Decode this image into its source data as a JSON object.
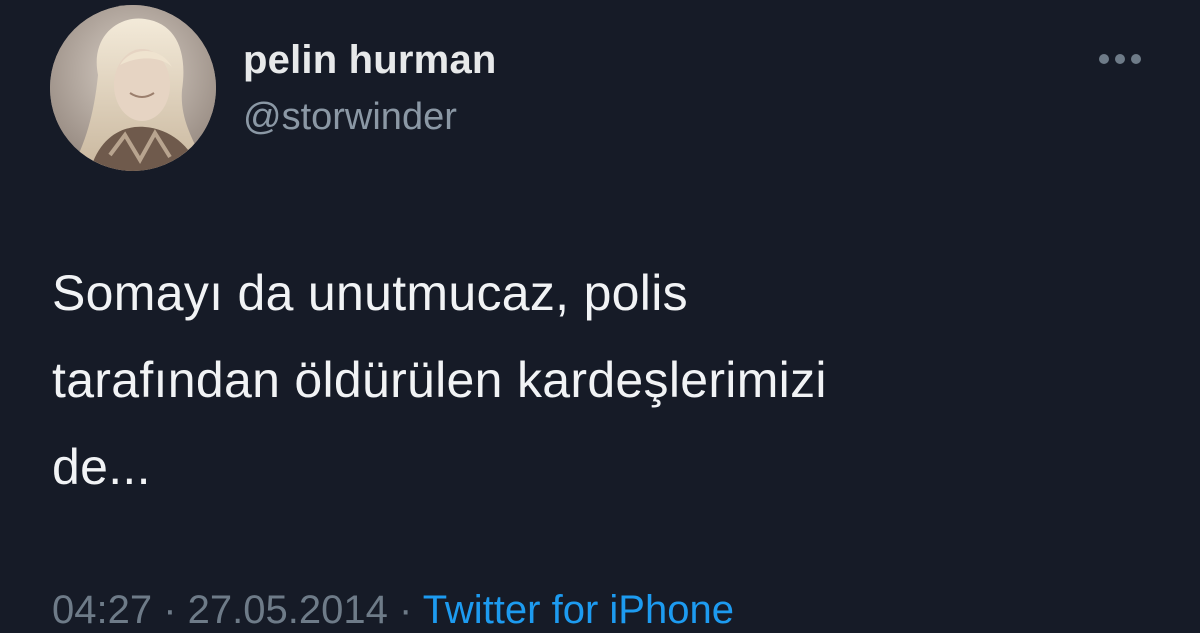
{
  "user": {
    "display_name": "pelin hurman",
    "handle": "@storwinder"
  },
  "tweet": {
    "lines": [
      "Somayı da unutmucaz, polis",
      "tarafından öldürülen kardeşlerimizi",
      "de..."
    ]
  },
  "meta": {
    "time": "04:27",
    "separator_1": " · ",
    "date": "27.05.2014",
    "separator_2": " · ",
    "source": "Twitter for iPhone"
  },
  "icons": {
    "more": "more-horizontal-icon",
    "avatar": "profile-photo"
  },
  "colors": {
    "background": "#161b27",
    "text": "#f1f3f5",
    "secondary": "#8b98a5",
    "link": "#1d9bf0"
  }
}
